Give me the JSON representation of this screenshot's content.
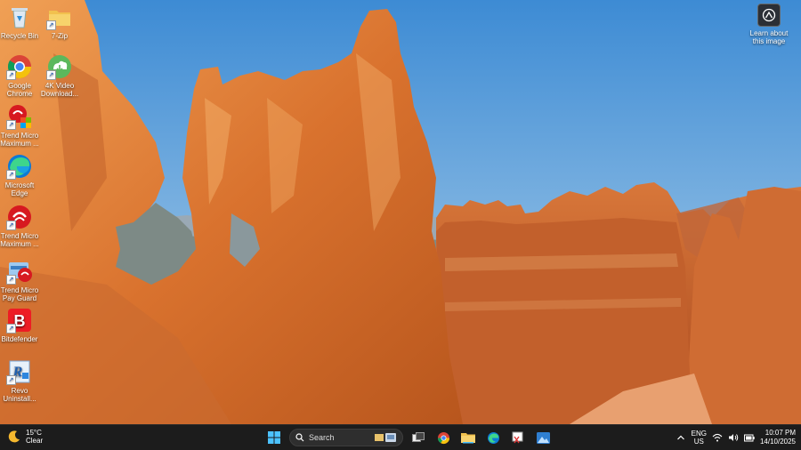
{
  "desktop": {
    "icons": [
      {
        "label": "Recycle Bin",
        "icon": "recycle-bin-icon"
      },
      {
        "label": "7-Zip",
        "icon": "folder-icon"
      },
      {
        "label": "Google\nChrome",
        "icon": "chrome-icon"
      },
      {
        "label": "4K Video\nDownload...",
        "icon": "4k-video-downloader-icon"
      },
      {
        "label": "Trend Micro\nMaximum ...",
        "icon": "trend-micro-icon"
      },
      {
        "label": "Microsoft\nEdge",
        "icon": "edge-icon"
      },
      {
        "label": "Trend Micro\nMaximum ...",
        "icon": "trend-micro-icon"
      },
      {
        "label": "Trend Micro\nPay Guard",
        "icon": "trend-micro-payguard-icon"
      },
      {
        "label": "Bitdefender",
        "icon": "bitdefender-icon"
      },
      {
        "label": "Revo\nUninstall...",
        "icon": "revo-uninstaller-icon"
      }
    ],
    "learn": {
      "label": "Learn about\nthis image"
    }
  },
  "taskbar": {
    "weather": {
      "temp": "15°C",
      "condition": "Clear",
      "icon": "moon-icon"
    },
    "search": {
      "placeholder": "Search"
    },
    "tray": {
      "lang_top": "ENG",
      "lang_bottom": "US",
      "time": "10:07 PM",
      "date": "14/10/2025"
    }
  },
  "colors": {
    "sky_top": "#3f8fd6",
    "sky_bottom": "#a9cde8",
    "rock": "#d9742f",
    "taskbar": "#1c1c1c"
  }
}
